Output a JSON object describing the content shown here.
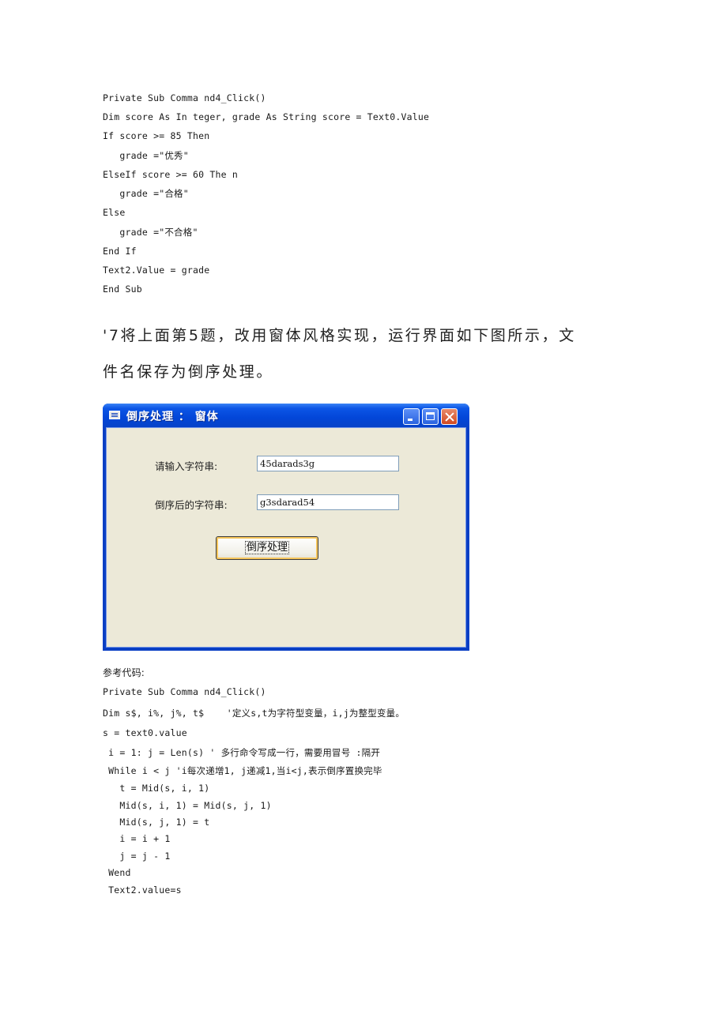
{
  "code_block_1": [
    "Private Sub Comma nd4_Click()",
    "Dim score As In teger, grade As String score = Text0.Value",
    "If score >= 85 Then",
    "   grade =\"优秀\"",
    "ElseIf score >= 60 The n",
    "   grade =\"合格\"",
    "Else",
    "   grade =\"不合格\"",
    "End If",
    "Text2.Value = grade",
    "End Sub"
  ],
  "question": {
    "line1": "'7将上面第5题，改用窗体风格实现，运行界面如下图所示，文",
    "line2": "件名保存为倒序处理。"
  },
  "window": {
    "title": "倒序处理 ： 窗体",
    "input_label": "请输入字符串:",
    "input_value": "45darads3g",
    "output_label": "倒序后的字符串:",
    "output_value": "g3sdarad54",
    "button_label": "倒序处理",
    "colors": {
      "titlebar": "#0346d8",
      "client": "#ece9d8",
      "close_button": "#d24a22"
    }
  },
  "reference_label": "参考代码:",
  "code_block_2": [
    "Private Sub Comma nd4_Click()",
    "Dim s$, i%, j%, t$    '定义s,t为字符型变量，i,j为整型变量。",
    "s = text0.value",
    " i = 1: j = Len(s) ' 多行命令写成一行，需要用冒号 :隔开",
    " While i < j 'i每次递增1, j递减1,当i<j,表示倒序置换完毕",
    "   t = Mid(s, i, 1)",
    "   Mid(s, i, 1) = Mid(s, j, 1)",
    "   Mid(s, j, 1) = t",
    "   i = i + 1",
    "   j = j - 1",
    " Wend",
    " Text2.value=s"
  ]
}
